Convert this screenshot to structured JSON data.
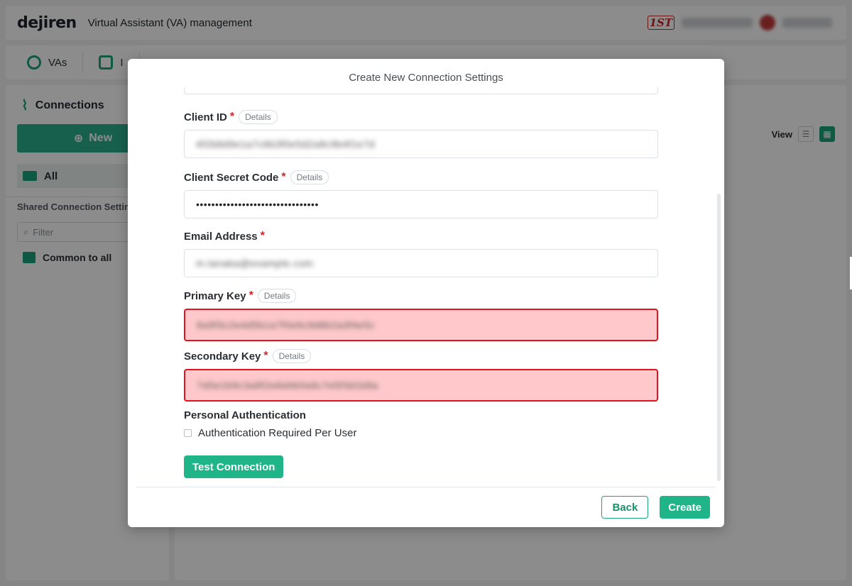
{
  "app": {
    "logo": "dejiren",
    "title": "Virtual Assistant (VA) management",
    "brand_badge": "1ST"
  },
  "nav": {
    "items": [
      {
        "label": "VAs"
      },
      {
        "label": "I"
      }
    ]
  },
  "sidebar": {
    "heading": "Connections",
    "new_label": "New",
    "all_label": "All",
    "shared_label": "Shared Connection Settings",
    "filter_placeholder": "Filter",
    "common_label": "Common to all"
  },
  "main": {
    "view_label": "View"
  },
  "modal": {
    "title": "Create New Connection Settings",
    "details_label": "Details",
    "required_mark": "*",
    "fields": {
      "client_id": {
        "label": "Client ID",
        "value": "4f2b8d9e1a7c6b3f0e5d2a8c9b4f1e7d"
      },
      "client_secret": {
        "label": "Client Secret Code",
        "value": "••••••••••••••••••••••••••••••••"
      },
      "email": {
        "label": "Email Address",
        "value": "m.tanaka@example.com"
      },
      "primary_key": {
        "label": "Primary Key",
        "value": "8a9f3c2e4d5b1a7f0e6c9d8b2a3f4e5c"
      },
      "secondary_key": {
        "label": "Secondary Key",
        "value": "7d5e1b9c3a8f2e6d4b0a9c7e5f3d1b8a"
      }
    },
    "personal_auth": {
      "label": "Personal Authentication",
      "checkbox_label": "Authentication Required Per User"
    },
    "test_button": "Test Connection",
    "back_button": "Back",
    "create_button": "Create"
  },
  "colors": {
    "accent": "#1fb588",
    "error_border": "#e2121f",
    "error_fill": "#ffc9cb",
    "required": "#d0232b"
  }
}
